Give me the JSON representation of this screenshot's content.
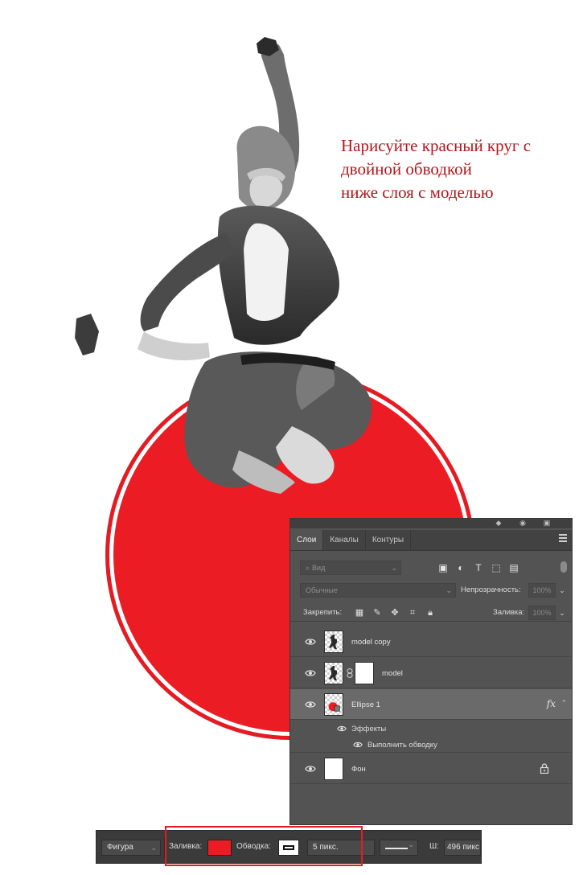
{
  "canvas": {
    "instruction_lines": [
      "Нарисуйте красный круг с",
      "двойной обводкой",
      "ниже слоя с моделью"
    ],
    "accent_color": "#ec1c24",
    "instruction_color": "#b4161c"
  },
  "layers_panel": {
    "tabs": [
      "Слои",
      "Каналы",
      "Контуры"
    ],
    "active_tab": "Слои",
    "search_placeholder": "Вид",
    "blend_mode": "Обычные",
    "opacity_label": "Непрозрачность:",
    "opacity_value": "100%",
    "lock_label": "Закрепить:",
    "fill_label": "Заливка:",
    "fill_value": "100%",
    "layers": [
      {
        "name": "model copy",
        "visible": true,
        "thumb": "model"
      },
      {
        "name": "model",
        "visible": true,
        "thumb": "model",
        "mask": true
      },
      {
        "name": "Ellipse 1",
        "visible": true,
        "thumb": "ellipse",
        "selected": true,
        "fx": "fx"
      },
      {
        "name": "Фон",
        "visible": true,
        "thumb": "white",
        "locked": true
      }
    ],
    "effects_label": "Эффекты",
    "effect_items": [
      "Выполнить обводку"
    ]
  },
  "options_bar": {
    "tool_mode": "Фигура",
    "fill_label": "Заливка:",
    "fill_color": "#ec1c24",
    "stroke_label": "Обводка:",
    "stroke_width": "5 пикс.",
    "width_label": "Ш:",
    "width_value": "496 пикс"
  }
}
